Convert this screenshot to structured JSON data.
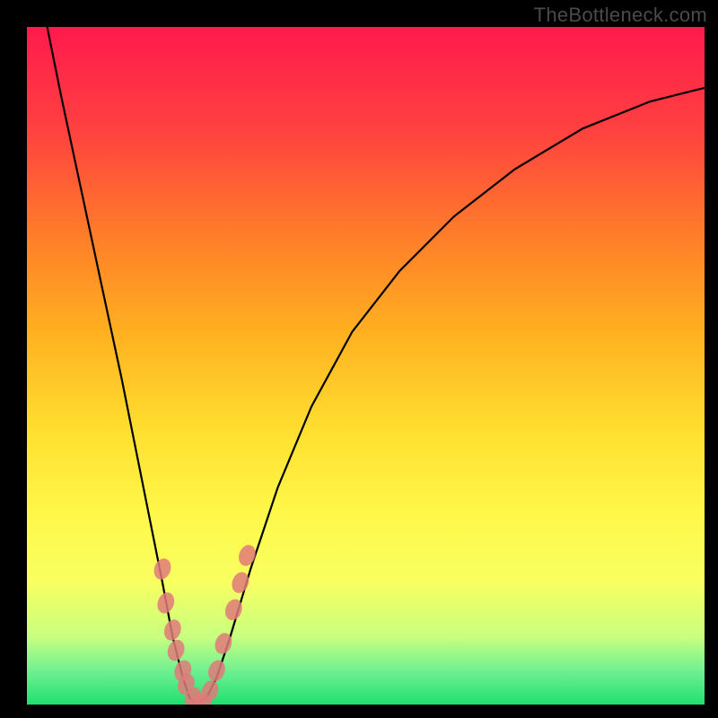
{
  "watermark": "TheBottleneck.com",
  "colors": {
    "background": "#000000",
    "gradient_top": "#ff1a4d",
    "gradient_bottom": "#20e070",
    "curve": "#000000",
    "marker_fill": "#e07a7a",
    "marker_stroke": "#8e3a3a"
  },
  "chart_data": {
    "type": "line",
    "title": "",
    "xlabel": "",
    "ylabel": "",
    "xlim": [
      0,
      100
    ],
    "ylim": [
      0,
      100
    ],
    "grid": false,
    "legend": false,
    "series": [
      {
        "name": "bottleneck-curve",
        "x": [
          3,
          5,
          8,
          11,
          14,
          16,
          18,
          20,
          21.5,
          23,
          24,
          25,
          26.5,
          28,
          30,
          33,
          37,
          42,
          48,
          55,
          63,
          72,
          82,
          92,
          100
        ],
        "y": [
          100,
          90,
          76,
          62,
          48,
          38,
          28,
          18,
          10,
          4,
          1,
          0,
          1,
          4,
          10,
          20,
          32,
          44,
          55,
          64,
          72,
          79,
          85,
          89,
          91
        ]
      }
    ],
    "markers": [
      {
        "x": 20.0,
        "y": 20
      },
      {
        "x": 20.5,
        "y": 15
      },
      {
        "x": 21.5,
        "y": 11
      },
      {
        "x": 22.0,
        "y": 8
      },
      {
        "x": 23.0,
        "y": 5
      },
      {
        "x": 23.5,
        "y": 3
      },
      {
        "x": 24.5,
        "y": 1
      },
      {
        "x": 25.0,
        "y": 0
      },
      {
        "x": 26.0,
        "y": 0
      },
      {
        "x": 27.0,
        "y": 2
      },
      {
        "x": 28.0,
        "y": 5
      },
      {
        "x": 29.0,
        "y": 9
      },
      {
        "x": 30.5,
        "y": 14
      },
      {
        "x": 31.5,
        "y": 18
      },
      {
        "x": 32.5,
        "y": 22
      }
    ]
  }
}
